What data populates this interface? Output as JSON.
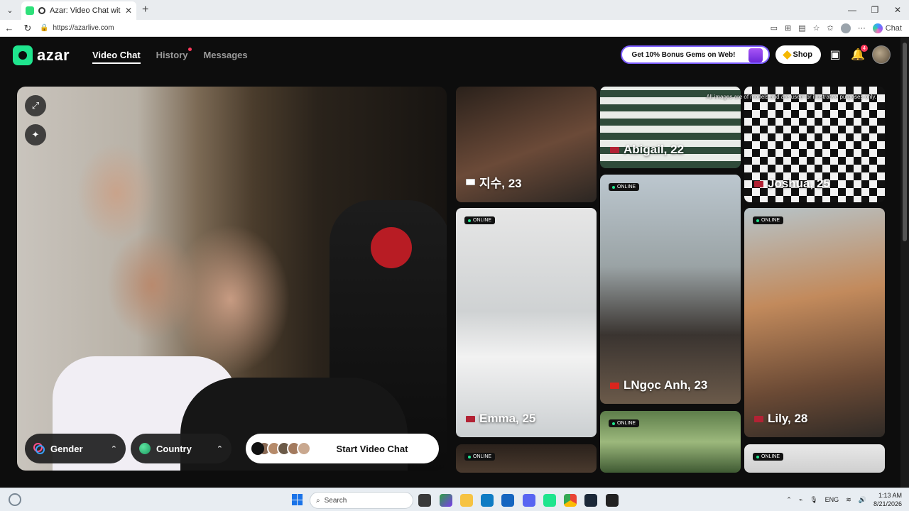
{
  "browser": {
    "tab_title": "Azar: Video Chat with New Pe",
    "url": "https://azarlive.com",
    "copilot_label": "Chat"
  },
  "site": {
    "logo_text": "azar",
    "nav": [
      {
        "label": "Video Chat",
        "active": true
      },
      {
        "label": "History",
        "has_dot": true
      },
      {
        "label": "Messages"
      }
    ],
    "bonus_label": "Get 10% Bonus Gems on Web!",
    "shop_label": "Shop",
    "notif_count": "4"
  },
  "video": {
    "gender_label": "Gender",
    "country_label": "Country",
    "start_label": "Start Video Chat"
  },
  "grid": {
    "disclaimer": "All images are of models and are used for illustrative purposes only.",
    "online_label": "ONLINE",
    "cards": [
      {
        "name": "지수, 23",
        "flag": "kr"
      },
      {
        "name": "Abigail, 22",
        "flag": "us"
      },
      {
        "name": "Joshua, 25",
        "flag": "us"
      },
      {
        "name": "Emma, 25",
        "flag": "us"
      },
      {
        "name": "LNgọc Anh, 23",
        "flag": "vn"
      },
      {
        "name": "Lily, 28",
        "flag": "us"
      }
    ]
  },
  "taskbar": {
    "search_placeholder": "Search",
    "lang": "ENG",
    "time": "1:13 AM",
    "date": "8/21/2026"
  },
  "colors": {
    "brand": "#1fe58e",
    "online_dot": "#1fe58e",
    "notif_dot": "#ff3b5c"
  }
}
